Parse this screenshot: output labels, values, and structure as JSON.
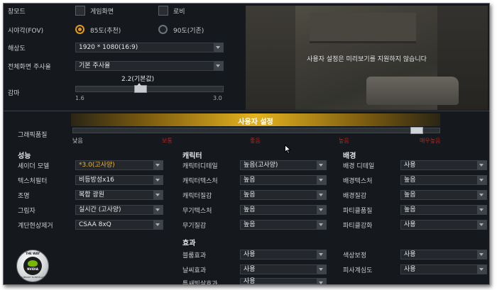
{
  "display": {
    "mode_label": "창모드",
    "mode_options": [
      "게임화면",
      "로비"
    ],
    "fov_label": "시야각(FOV)",
    "fov_options": [
      "85도(추천)",
      "90도(기존)"
    ],
    "resolution_label": "해상도",
    "resolution_value": "1920 * 1080(16:9)",
    "refresh_label": "전체화면 주사율",
    "refresh_value": "기본 주사율",
    "gamma_label": "감마",
    "gamma_value_label": "2.2(기본값)",
    "gamma_min": "1.6",
    "gamma_max": "3.0",
    "gamma_level": 0.43
  },
  "preview": {
    "message": "사용자 설정은 미리보기를 지원하지 않습니다"
  },
  "quality": {
    "label": "그래픽품질",
    "preset_title": "사용자 설정",
    "levels": [
      "낮음",
      "보통",
      "좋음",
      "높음",
      "매우높음"
    ],
    "slider_level": 0.95
  },
  "performance": {
    "title": "성능",
    "rows": [
      {
        "label": "셰이더 모델",
        "value": "*3.0(고사양)"
      },
      {
        "label": "텍스처필터",
        "value": "비등방성x16"
      },
      {
        "label": "조명",
        "value": "복합 광원"
      },
      {
        "label": "그림자",
        "value": "실시간 (고사양)"
      },
      {
        "label": "계단현상제거",
        "value": "CSAA 8xQ"
      }
    ]
  },
  "character": {
    "title": "캐릭터",
    "rows": [
      {
        "label": "캐릭터디테일",
        "value": "높음(고사양)"
      },
      {
        "label": "캐릭터텍스처",
        "value": "높음"
      },
      {
        "label": "캐릭터질감",
        "value": "높음"
      },
      {
        "label": "무기텍스처",
        "value": "높음"
      },
      {
        "label": "무기질감",
        "value": "높음"
      }
    ]
  },
  "background": {
    "title": "배경",
    "rows": [
      {
        "label": "배경 디테일",
        "value": "사용"
      },
      {
        "label": "배경텍스처",
        "value": "높음"
      },
      {
        "label": "배경질감",
        "value": "높음"
      },
      {
        "label": "파티클품질",
        "value": "높음"
      },
      {
        "label": "파티클강화",
        "value": "사용"
      }
    ]
  },
  "effects": {
    "title": "효과",
    "rows": [
      {
        "label": "블룸효과",
        "value": "사용"
      },
      {
        "label": "날씨효과",
        "value": "사용"
      },
      {
        "label": "틈새빛살효과",
        "value": "사용"
      }
    ],
    "extra_rows": [
      {
        "label": "색상보정",
        "value": "사용"
      },
      {
        "label": "피사계심도",
        "value": "사용"
      }
    ]
  },
  "badge": {
    "top_text": "THE WAY",
    "bottom_text": "IT'S MEANT TO BE PLAYED",
    "brand": "NVIDIA"
  },
  "colors": {
    "accent": "#e39a1b",
    "level_red": "#c0201a",
    "panel": "#15191d"
  }
}
